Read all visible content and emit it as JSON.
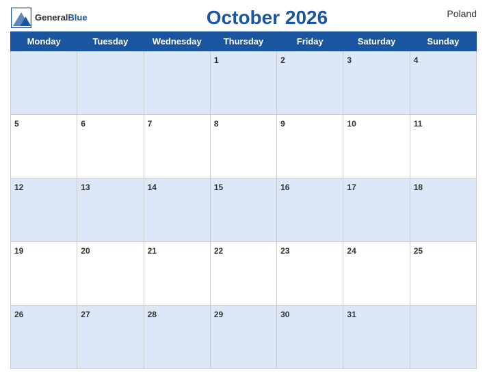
{
  "header": {
    "title": "October 2026",
    "country": "Poland",
    "logo_general": "General",
    "logo_blue": "Blue"
  },
  "weekdays": [
    "Monday",
    "Tuesday",
    "Wednesday",
    "Thursday",
    "Friday",
    "Saturday",
    "Sunday"
  ],
  "weeks": [
    [
      null,
      null,
      null,
      1,
      2,
      3,
      4
    ],
    [
      5,
      6,
      7,
      8,
      9,
      10,
      11
    ],
    [
      12,
      13,
      14,
      15,
      16,
      17,
      18
    ],
    [
      19,
      20,
      21,
      22,
      23,
      24,
      25
    ],
    [
      26,
      27,
      28,
      29,
      30,
      31,
      null
    ]
  ]
}
